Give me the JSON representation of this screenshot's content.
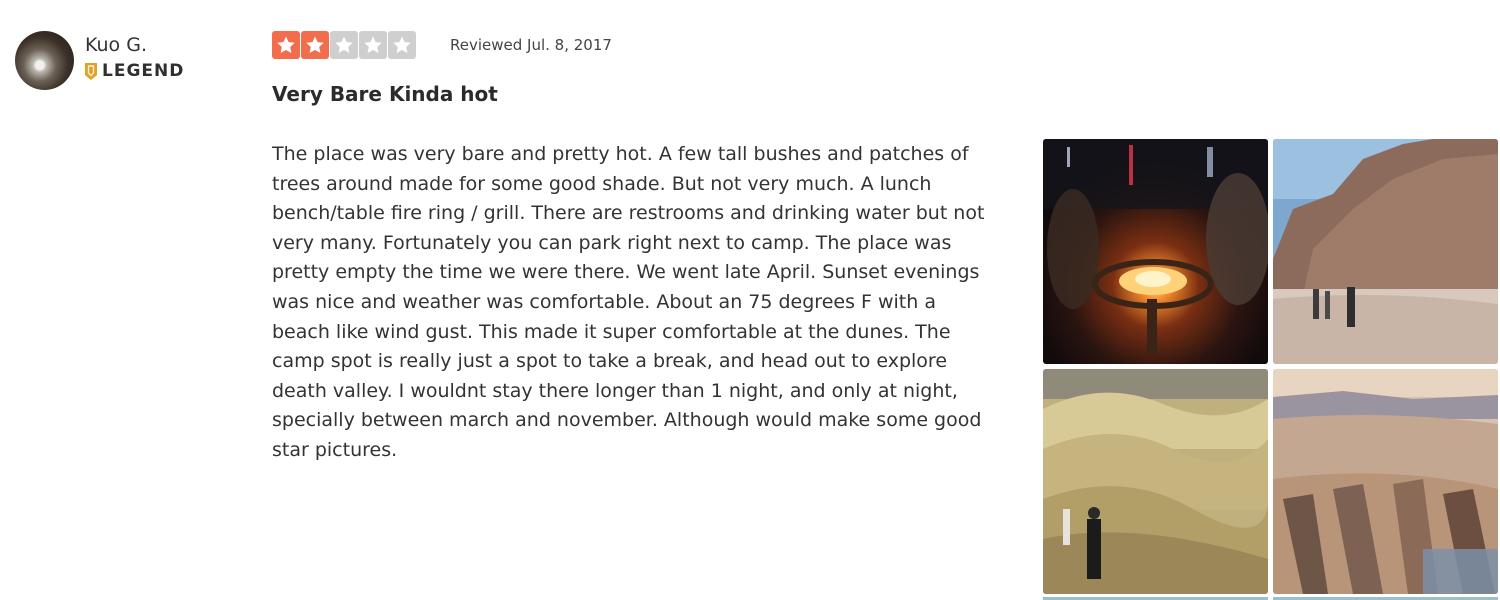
{
  "reviewer": {
    "name": "Kuo G.",
    "badge": "LEGEND",
    "badge_color": "#e0a126"
  },
  "review": {
    "rating": 2,
    "max_rating": 5,
    "star_on_color": "#f26d4b",
    "star_off_color": "#cfcfcf",
    "date": "Reviewed Jul. 8, 2017",
    "title": "Very Bare Kinda hot",
    "body": "The place was very bare and pretty hot. A few tall bushes and patches of trees around made for some good shade. But not very much. A lunch bench/table fire ring / grill. There are restrooms and drinking water but not very many. Fortunately you can park right next to camp. The place was pretty empty the time we were there. We went late April. Sunset evenings was nice and weather was comfortable. About an 75 degrees F with a beach like wind gust. This made it super comfortable at the dunes. The camp spot is really just a spot to take a break, and head out to explore death valley. I wouldnt stay there longer than 1 night, and only at night, specially between march and november. Although would make some good star pictures."
  },
  "photos": [
    {
      "icon": "campfire-photo"
    },
    {
      "icon": "canyon-hikers-photo"
    },
    {
      "icon": "badlands-photo"
    },
    {
      "icon": "dunes-legs-photo"
    }
  ]
}
